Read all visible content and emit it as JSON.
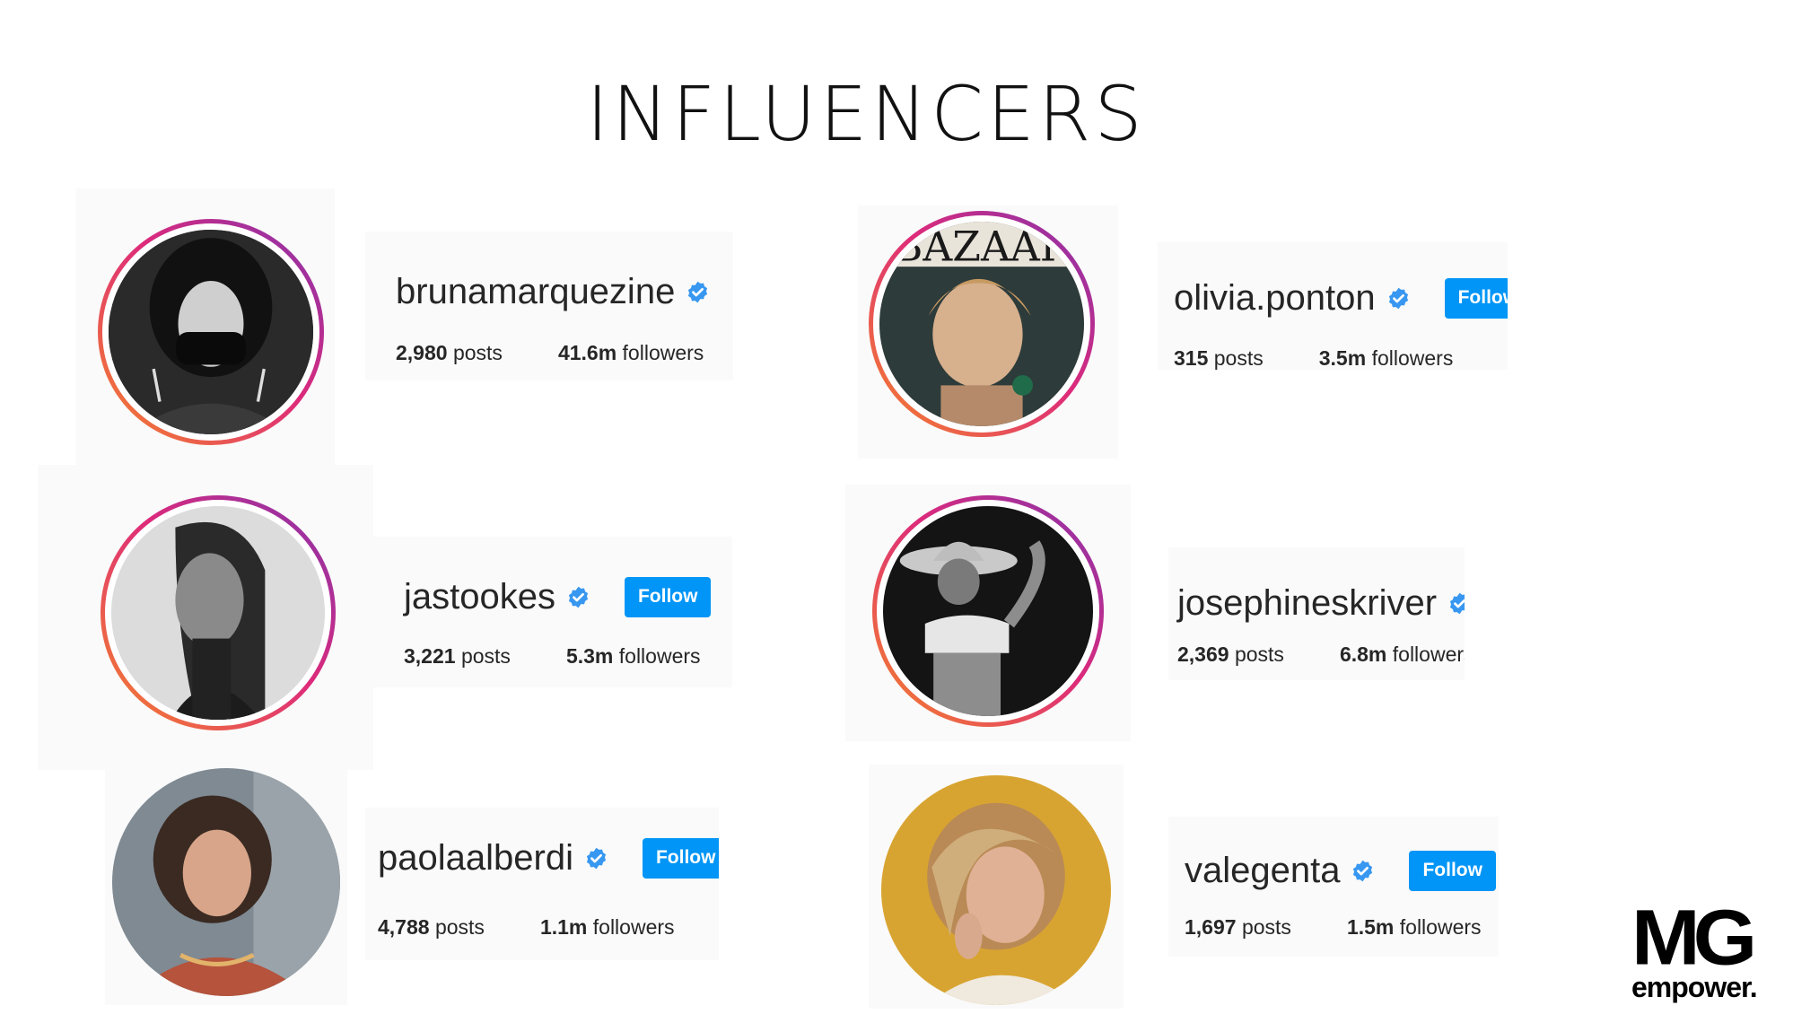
{
  "title": "INFLUENCERS",
  "profiles": [
    {
      "username": "brunamarquezine",
      "follow_label": "",
      "posts_count": "2,980",
      "posts_word": "posts",
      "followers_count": "41.6m",
      "followers_word": "followers"
    },
    {
      "username": "olivia.ponton",
      "follow_label": "Follow",
      "posts_count": "315",
      "posts_word": "posts",
      "followers_count": "3.5m",
      "followers_word": "followers"
    },
    {
      "username": "jastookes",
      "follow_label": "Follow",
      "posts_count": "3,221",
      "posts_word": "posts",
      "followers_count": "5.3m",
      "followers_word": "followers"
    },
    {
      "username": "josephineskriver",
      "follow_label": "",
      "posts_count": "2,369",
      "posts_word": "posts",
      "followers_count": "6.8m",
      "followers_word": "followers"
    },
    {
      "username": "paolaalberdi",
      "follow_label": "Follow",
      "posts_count": "4,788",
      "posts_word": "posts",
      "followers_count": "1.1m",
      "followers_word": "followers"
    },
    {
      "username": "valegenta",
      "follow_label": "Follow",
      "posts_count": "1,697",
      "posts_word": "posts",
      "followers_count": "1.5m",
      "followers_word": "followers"
    }
  ],
  "logo": {
    "mark": "MG",
    "wordmark": "empower."
  },
  "colors": {
    "follow_button": "#0095f6",
    "verified_badge": "#3897f0",
    "story_ring_start": "#f58529",
    "story_ring_end": "#dd2a7b"
  },
  "icons": {
    "verified": "verified-badge-icon"
  }
}
